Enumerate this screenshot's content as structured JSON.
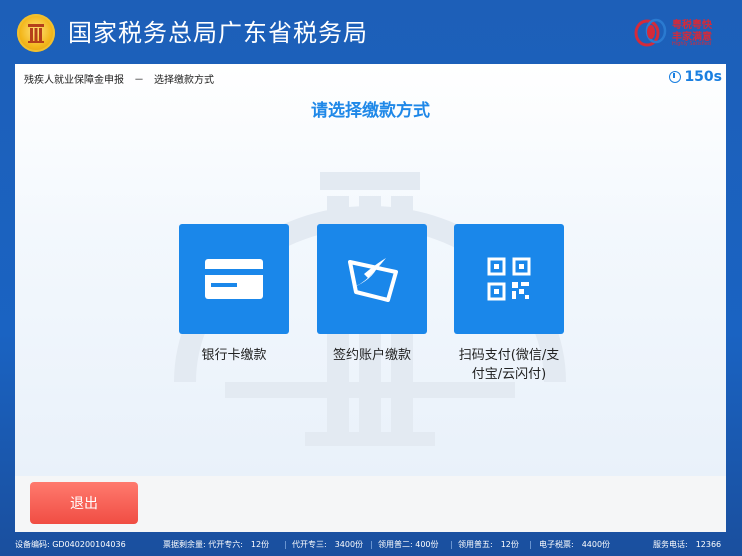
{
  "header": {
    "agency": "国家税务总局广东省税务局",
    "brand_line1": "粤税粤快",
    "brand_line2": "丰家满意",
    "brand_line3": "Highly Satisfied"
  },
  "panel": {
    "breadcrumb": "残疾人就业保障金申报　－　选择缴款方式",
    "timer": "150s",
    "heading": "请选择缴款方式",
    "options": [
      {
        "label": "银行卡缴款",
        "icon": "bank-card-icon"
      },
      {
        "label": "签约账户缴款",
        "icon": "signed-account-icon"
      },
      {
        "label_line1": "扫码支付(微信/支",
        "label_line2": "付宝/云闪付)",
        "icon": "qr-code-icon"
      }
    ]
  },
  "actions": {
    "exit": "退出"
  },
  "footer": {
    "device": "设备编码: GD040200104036",
    "remaining": "票据剩余量: 代开专六:　12份",
    "dz3": "代开专三:　3400份",
    "lyp2": "领用普二: 400份",
    "lyp5": "领用普五:　12份",
    "edp": "电子税票:　4400份",
    "hotline": "服务电话:　12366"
  },
  "colors": {
    "accent": "#1a87ea",
    "exit": "#f04d43",
    "header_bg": "#1d5fb8"
  }
}
